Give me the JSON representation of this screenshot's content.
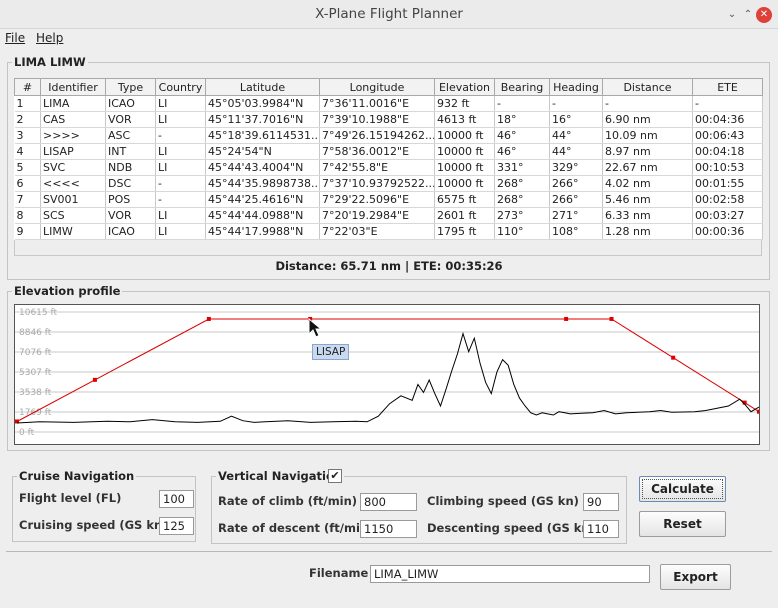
{
  "window": {
    "title": "X-Plane Flight Planner",
    "min_glyph": "⌄",
    "max_glyph": "⌃",
    "close_glyph": "✕"
  },
  "menu": {
    "file": "File",
    "help": "Help"
  },
  "route_panel": {
    "title": "LIMA LIMW"
  },
  "table": {
    "columns": [
      "#",
      "Identifier",
      "Type",
      "Country",
      "Latitude",
      "Longitude",
      "Elevation",
      "Bearing",
      "Heading",
      "Distance",
      "ETE"
    ],
    "rows": [
      [
        "1",
        "LIMA",
        "ICAO",
        "LI",
        "45°05'03.9984\"N",
        "7°36'11.0016\"E",
        "932 ft",
        "-",
        "-",
        "-",
        "-"
      ],
      [
        "2",
        "CAS",
        "VOR",
        "LI",
        "45°11'37.7016\"N",
        "7°39'10.1988\"E",
        "4613 ft",
        "18°",
        "16°",
        "6.90 nm",
        "00:04:36"
      ],
      [
        "3",
        ">>>>",
        "ASC",
        "-",
        "45°18'39.6114531...",
        "7°49'26.15194262...",
        "10000 ft",
        "46°",
        "44°",
        "10.09 nm",
        "00:06:43"
      ],
      [
        "4",
        "LISAP",
        "INT",
        "LI",
        "45°24'54\"N",
        "7°58'36.0012\"E",
        "10000 ft",
        "46°",
        "44°",
        "8.97 nm",
        "00:04:18"
      ],
      [
        "5",
        "SVC",
        "NDB",
        "LI",
        "45°44'43.4004\"N",
        "7°42'55.8\"E",
        "10000 ft",
        "331°",
        "329°",
        "22.67 nm",
        "00:10:53"
      ],
      [
        "6",
        "<<<<",
        "DSC",
        "-",
        "45°44'35.9898738...",
        "7°37'10.93792522...",
        "10000 ft",
        "268°",
        "266°",
        "4.02 nm",
        "00:01:55"
      ],
      [
        "7",
        "SV001",
        "POS",
        "-",
        "45°44'25.4616\"N",
        "7°29'22.5096\"E",
        "6575 ft",
        "268°",
        "266°",
        "5.46 nm",
        "00:02:58"
      ],
      [
        "8",
        "SCS",
        "VOR",
        "LI",
        "45°44'44.0988\"N",
        "7°20'19.2984\"E",
        "2601 ft",
        "273°",
        "271°",
        "6.33 nm",
        "00:03:27"
      ],
      [
        "9",
        "LIMW",
        "ICAO",
        "LI",
        "45°44'17.9988\"N",
        "7°22'03\"E",
        "1795 ft",
        "110°",
        "108°",
        "1.28 nm",
        "00:00:36"
      ]
    ]
  },
  "summary": "Distance: 65.71 nm | ETE: 00:35:26",
  "elevation": {
    "title": "Elevation profile",
    "tooltip": "LISAP"
  },
  "chart_data": {
    "type": "line",
    "ylim": [
      0,
      10615
    ],
    "yticks": [
      "10615 ft",
      "8846 ft",
      "7076 ft",
      "5307 ft",
      "3538 ft",
      "1769 ft",
      "0 ft"
    ],
    "xlim": [
      0,
      65.71
    ],
    "grid": true,
    "series": [
      {
        "color": "#dd0000",
        "markers": true,
        "x": [
          0,
          6.9,
          16.99,
          25.96,
          48.63,
          52.65,
          58.11,
          64.44,
          65.71
        ],
        "values": [
          932,
          4613,
          10000,
          10000,
          10000,
          10000,
          6575,
          2601,
          1795
        ]
      },
      {
        "color": "#000000",
        "markers": false,
        "x": [
          0,
          2,
          5,
          8,
          10,
          12,
          14,
          16,
          18,
          19,
          20,
          21,
          22,
          24,
          26,
          28,
          30,
          31,
          32,
          33,
          34,
          35,
          35.5,
          36,
          36.5,
          37,
          37.5,
          38,
          38.5,
          39,
          39.5,
          40,
          40.5,
          41,
          41.5,
          42,
          42.5,
          43,
          43.5,
          44,
          44.5,
          45,
          45.5,
          46,
          46.5,
          47,
          47.5,
          48,
          48.5,
          49,
          50,
          51,
          52,
          53,
          54,
          56,
          57,
          58,
          60,
          61,
          62,
          63,
          64,
          64.5,
          65,
          65.71
        ],
        "values": [
          800,
          900,
          850,
          950,
          900,
          1100,
          900,
          850,
          950,
          1400,
          1000,
          850,
          900,
          1000,
          850,
          900,
          950,
          900,
          1400,
          2500,
          3200,
          2800,
          4200,
          3500,
          4600,
          3400,
          2300,
          3800,
          5400,
          6900,
          8700,
          7100,
          8300,
          6100,
          4400,
          3400,
          5300,
          6400,
          5900,
          4200,
          3000,
          2300,
          1700,
          1500,
          1700,
          1600,
          1500,
          1800,
          1700,
          1600,
          1650,
          1700,
          1900,
          1600,
          1700,
          1800,
          1900,
          1750,
          1800,
          1900,
          2100,
          2300,
          2900,
          2400,
          1800,
          2200
        ]
      }
    ]
  },
  "cruise": {
    "title": "Cruise Navigation",
    "fl_label": "Flight level (FL)",
    "fl_value": "100",
    "speed_label": "Cruising speed (GS kn)",
    "speed_value": "125"
  },
  "vertical": {
    "title": "Vertical Navigation",
    "enabled_mark": "✔",
    "climb_label": "Rate of climb (ft/min)",
    "climb_value": "800",
    "descent_label": "Rate of descent (ft/min)",
    "descent_value": "1150",
    "climb_speed_label": "Climbing speed (GS kn)",
    "climb_speed_value": "90",
    "descent_speed_label": "Descenting speed (GS kn)",
    "descent_speed_value": "110"
  },
  "buttons": {
    "calculate": "Calculate",
    "reset": "Reset",
    "export": "Export"
  },
  "file": {
    "label": "Filename",
    "value": "LIMA_LIMW"
  }
}
